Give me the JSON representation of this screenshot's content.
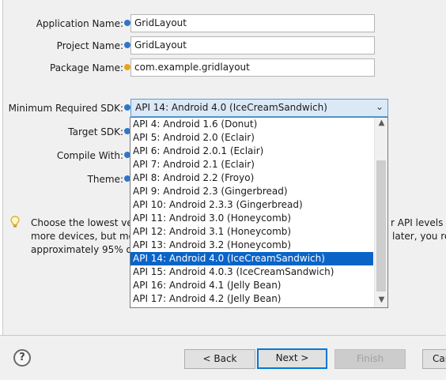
{
  "form": {
    "application_name_label": "Application Name:",
    "application_name_value": "GridLayout",
    "project_name_label": "Project Name:",
    "project_name_value": "GridLayout",
    "package_name_label": "Package Name:",
    "package_name_value": "com.example.gridlayout",
    "min_sdk_label": "Minimum Required SDK:",
    "min_sdk_value": "API 14: Android 4.0 (IceCreamSandwich)",
    "target_sdk_label": "Target SDK:",
    "compile_with_label": "Compile With:",
    "theme_label": "Theme:"
  },
  "dropdown": {
    "options": [
      "API 4: Android 1.6 (Donut)",
      "API 5: Android 2.0 (Eclair)",
      "API 6: Android 2.0.1 (Eclair)",
      "API 7: Android 2.1 (Eclair)",
      "API 8: Android 2.2 (Froyo)",
      "API 9: Android 2.3 (Gingerbread)",
      "API 10: Android 2.3.3 (Gingerbread)",
      "API 11: Android 3.0 (Honeycomb)",
      "API 12: Android 3.1 (Honeycomb)",
      "API 13: Android 3.2 (Honeycomb)",
      "API 14: Android 4.0 (IceCreamSandwich)",
      "API 15: Android 4.0.3 (IceCreamSandwich)",
      "API 16: Android 4.1 (Jelly Bean)",
      "API 17: Android 4.2 (Jelly Bean)"
    ],
    "selected_index": 10
  },
  "info": {
    "line1_left": "Choose the lowest ver",
    "line1_right": "r API levels t",
    "line2_left": "more devices, but me",
    "line2_right": "later, you re",
    "line3_left": "approximately 95% of"
  },
  "buttons": {
    "help": "?",
    "back": "< Back",
    "next": "Next >",
    "finish": "Finish",
    "cancel": "Can"
  },
  "colors": {
    "selection": "#0a64c8",
    "combo_bg": "#dbe9f7",
    "info_icon": "#2f76c8",
    "warning_icon": "#e8a318"
  }
}
